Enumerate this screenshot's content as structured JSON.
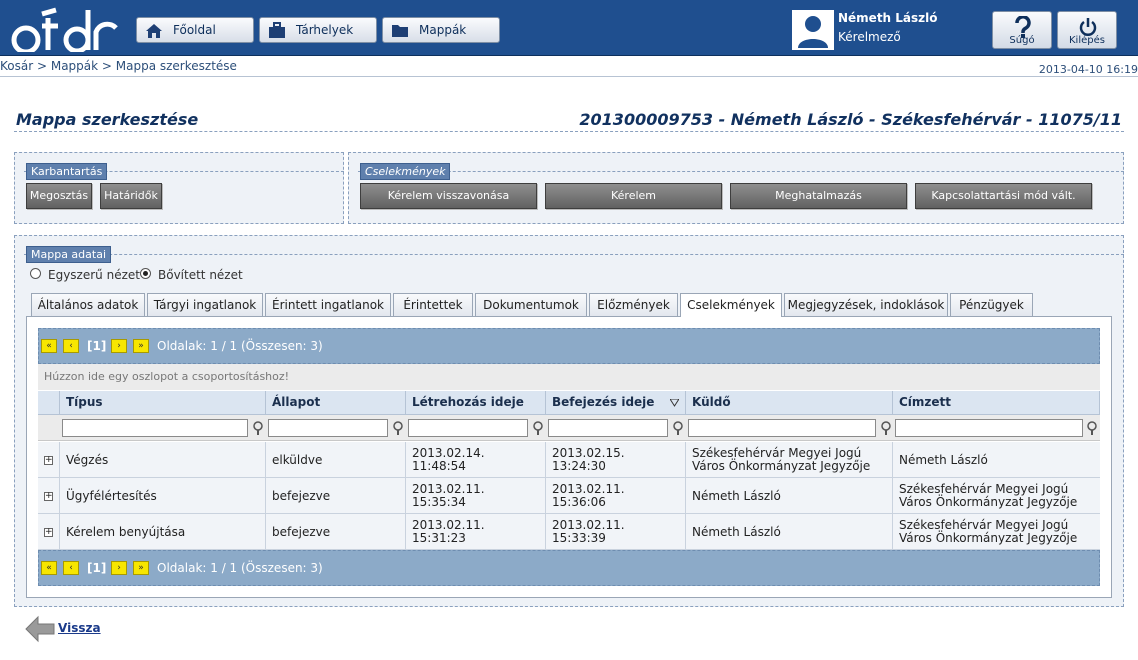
{
  "header": {
    "nav": [
      {
        "label": "Főoldal",
        "icon": "home-icon"
      },
      {
        "label": "Tárhelyek",
        "icon": "briefcase-icon"
      },
      {
        "label": "Mappák",
        "icon": "folder-icon"
      }
    ],
    "user_name": "Németh László",
    "user_role": "Kérelmező",
    "help_label": "Súgó",
    "logout_label": "Kilépés"
  },
  "breadcrumb": "Kosár > Mappák > Mappa szerkesztése",
  "datetime": "2013-04-10 16:19",
  "page_title": "Mappa szerkesztése",
  "folder_title": "201300009753 - Németh László - Székesfehérvár - 11075/11",
  "maintenance": {
    "legend": "Karbantartás",
    "buttons": [
      "Megosztás",
      "Határidők"
    ]
  },
  "actions": {
    "legend": "Cselekmények",
    "buttons": [
      "Kérelem visszavonása",
      "Kérelem",
      "Meghatalmazás",
      "Kapcsolattartási mód vált."
    ]
  },
  "folder_data": {
    "legend": "Mappa adatai",
    "view_simple": "Egyszerű nézet",
    "view_extended": "Bővített nézet",
    "selected_view": "extended"
  },
  "tabs": [
    "Általános adatok",
    "Tárgyi ingatlanok",
    "Érintett ingatlanok",
    "Érintettek",
    "Dokumentumok",
    "Előzmények",
    "Cselekmények",
    "Megjegyzések, indoklások",
    "Pénzügyek"
  ],
  "active_tab": "Cselekmények",
  "grid": {
    "pager": {
      "current": "[1]",
      "info": "Oldalak: 1 / 1 (Összesen: 3)"
    },
    "group_hint": "Húzzon ide egy oszlopot a csoportosításhoz!",
    "columns": [
      "Típus",
      "Állapot",
      "Létrehozás ideje",
      "Befejezés ideje",
      "Küldő",
      "Címzett"
    ],
    "rows": [
      {
        "type": "Végzés",
        "status": "elküldve",
        "created": "2013.02.14. 11:48:54",
        "finished": "2013.02.15. 13:24:30",
        "sender": "Székesfehérvár Megyei Jogú Város Önkormányzat Jegyzője",
        "recipient": "Németh László"
      },
      {
        "type": "Ügyfélértesítés",
        "status": "befejezve",
        "created": "2013.02.11. 15:35:34",
        "finished": "2013.02.11. 15:36:06",
        "sender": "Németh László",
        "recipient": "Székesfehérvár Megyei Jogú Város Önkormányzat Jegyzője"
      },
      {
        "type": "Kérelem benyújtása",
        "status": "befejezve",
        "created": "2013.02.11. 15:31:23",
        "finished": "2013.02.11. 15:33:39",
        "sender": "Németh László",
        "recipient": "Székesfehérvár Megyei Jogú Város Önkormányzat Jegyzője"
      }
    ]
  },
  "back_label": "Vissza",
  "colors": {
    "header": "#1f4f8f",
    "legend": "#5f80ad",
    "pager": "#8caac8",
    "pager_button": "#f7e600"
  }
}
